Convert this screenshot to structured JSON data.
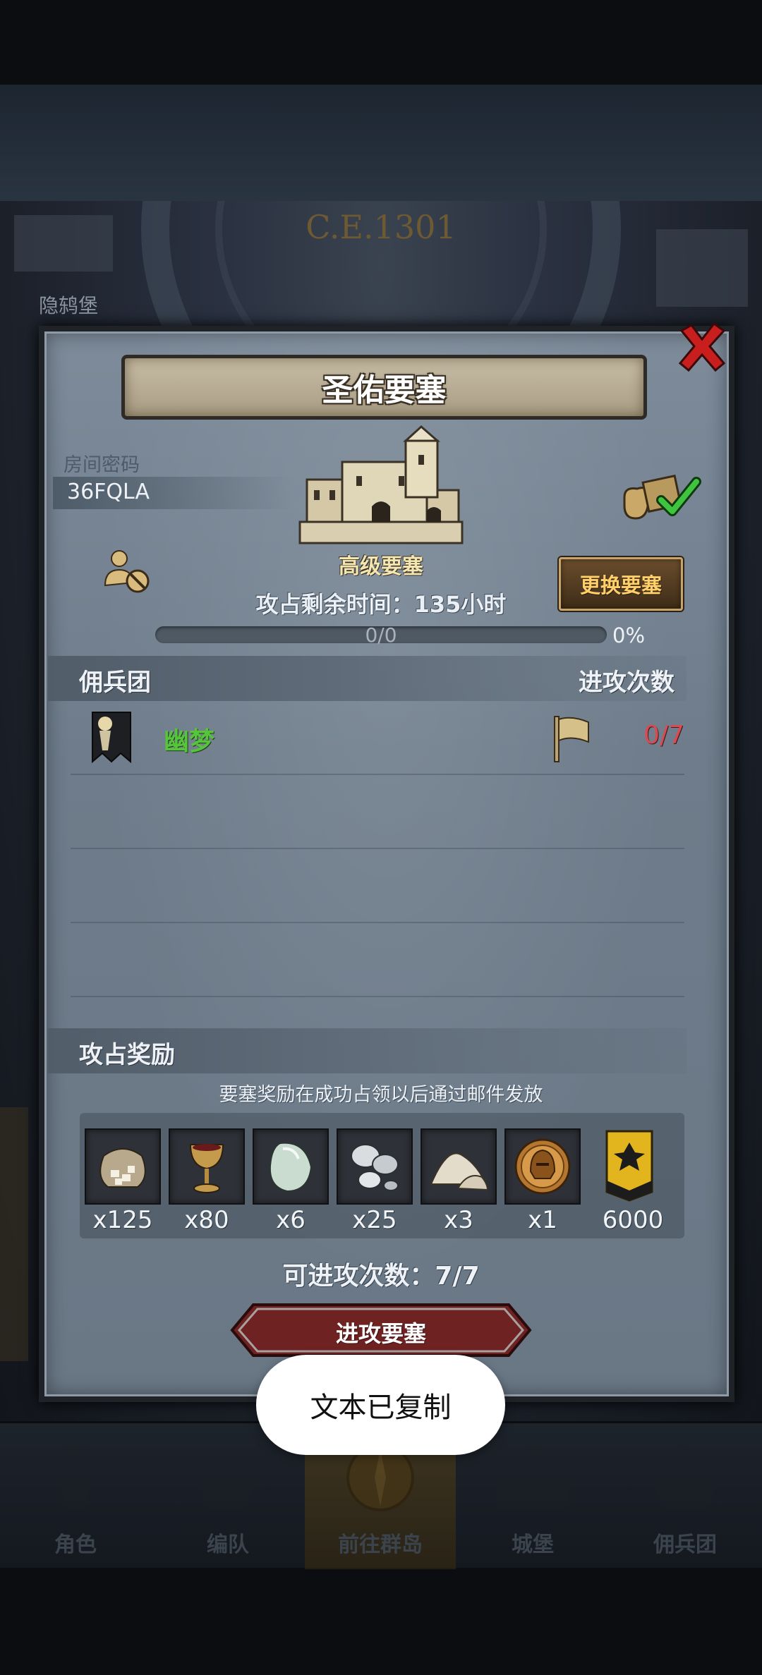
{
  "background": {
    "year": "C.E.1301",
    "map_label": "隐鸫堡"
  },
  "dialog": {
    "title": "圣佑要塞",
    "room": {
      "label": "房间密码",
      "code": "36FQLA"
    },
    "fortress_level": "高级要塞",
    "change_button": "更换要塞",
    "remaining_time": "攻占剩余时间：135小时",
    "progress": {
      "text": "0/0",
      "percent_text": "0%",
      "fraction": 0
    },
    "mercenary_section": {
      "title": "佣兵团",
      "count_header": "进攻次数",
      "rows": [
        {
          "name": "幽梦",
          "count": "0/7"
        }
      ]
    },
    "reward_section": {
      "title": "攻占奖励",
      "note": "要塞奖励在成功占领以后通过邮件发放",
      "items": [
        {
          "icon": "sack-icon",
          "qty": "x125"
        },
        {
          "icon": "goblet-icon",
          "qty": "x80"
        },
        {
          "icon": "gem-icon",
          "qty": "x6"
        },
        {
          "icon": "silver-icon",
          "qty": "x25"
        },
        {
          "icon": "sand-icon",
          "qty": "x3"
        },
        {
          "icon": "helmet-medal-icon",
          "qty": "x1"
        },
        {
          "icon": "rank-banner-icon",
          "qty": "6000"
        }
      ]
    },
    "attack_times": "可进攻次数：7/7",
    "attack_button": "进攻要塞"
  },
  "bottom_nav": {
    "items": [
      {
        "label": "角色",
        "icon": "knight-icon"
      },
      {
        "label": "编队",
        "icon": "squad-icon"
      },
      {
        "label": "前往群岛",
        "icon": "compass-icon",
        "active": true
      },
      {
        "label": "城堡",
        "icon": "castle-icon"
      },
      {
        "label": "佣兵团",
        "icon": "ship-icon"
      }
    ]
  },
  "toast": "文本已复制",
  "colors": {
    "panel": "#74828f",
    "merc_name": "#56c53b",
    "attack_count": "#d94b50",
    "change_button_text": "#ffcf6a",
    "attack_button": "#7a2525"
  }
}
